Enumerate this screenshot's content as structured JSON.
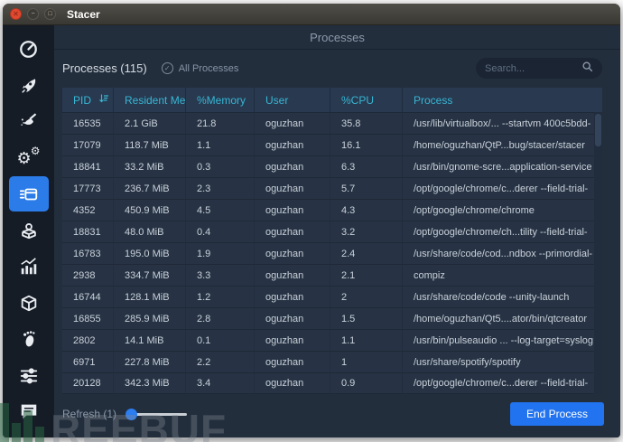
{
  "window": {
    "title": "Stacer",
    "controls": {
      "close": "✕",
      "minimize": "−",
      "maximize": "□"
    }
  },
  "header": {
    "title": "Processes"
  },
  "toolbar": {
    "section_title": "Processes (115)",
    "all_processes_label": "All Processes",
    "all_processes_checked": true,
    "check_glyph": "✓",
    "search_placeholder": "Search..."
  },
  "table": {
    "columns": [
      "PID",
      "Resident Mem",
      "%Memory",
      "User",
      "%CPU",
      "Process"
    ],
    "rows": [
      [
        "16535",
        "2.1 GiB",
        "21.8",
        "oguzhan",
        "35.8",
        "/usr/lib/virtualbox/... --startvm 400c5bdd-"
      ],
      [
        "17079",
        "118.7 MiB",
        "1.1",
        "oguzhan",
        "16.1",
        "/home/oguzhan/QtP...bug/stacer/stacer"
      ],
      [
        "18841",
        "33.2 MiB",
        "0.3",
        "oguzhan",
        "6.3",
        "/usr/bin/gnome-scre...application-service"
      ],
      [
        "17773",
        "236.7 MiB",
        "2.3",
        "oguzhan",
        "5.7",
        "/opt/google/chrome/c...derer --field-trial-"
      ],
      [
        "4352",
        "450.9 MiB",
        "4.5",
        "oguzhan",
        "4.3",
        "/opt/google/chrome/chrome"
      ],
      [
        "18831",
        "48.0 MiB",
        "0.4",
        "oguzhan",
        "3.2",
        "/opt/google/chrome/ch...tility --field-trial-"
      ],
      [
        "16783",
        "195.0 MiB",
        "1.9",
        "oguzhan",
        "2.4",
        "/usr/share/code/cod...ndbox --primordial-"
      ],
      [
        "2938",
        "334.7 MiB",
        "3.3",
        "oguzhan",
        "2.1",
        "compiz"
      ],
      [
        "16744",
        "128.1 MiB",
        "1.2",
        "oguzhan",
        "2",
        "/usr/share/code/code --unity-launch"
      ],
      [
        "16855",
        "285.9 MiB",
        "2.8",
        "oguzhan",
        "1.5",
        "/home/oguzhan/Qt5....ator/bin/qtcreator"
      ],
      [
        "2802",
        "14.1 MiB",
        "0.1",
        "oguzhan",
        "1.1",
        "/usr/bin/pulseaudio ... --log-target=syslog"
      ],
      [
        "6971",
        "227.8 MiB",
        "2.2",
        "oguzhan",
        "1",
        "/usr/share/spotify/spotify"
      ],
      [
        "20128",
        "342.3 MiB",
        "3.4",
        "oguzhan",
        "0.9",
        "/opt/google/chrome/c...derer --field-trial-"
      ]
    ]
  },
  "footer": {
    "refresh_label": "Refresh (1)",
    "end_process_label": "End Process"
  },
  "watermark": {
    "text": "REEBUF"
  },
  "colors": {
    "accent": "#2b7ce9",
    "button": "#2173ef",
    "cyan": "#38b6d3",
    "close": "#e0482f"
  }
}
